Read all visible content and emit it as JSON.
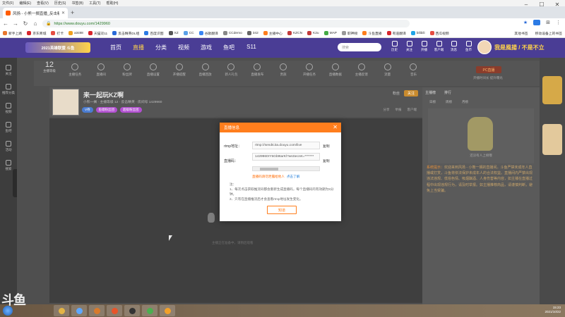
{
  "browser": {
    "menu": [
      "文件(F)",
      "编辑(E)",
      "查看(V)",
      "历史(S)",
      "书签(B)",
      "工具(T)",
      "帮助(H)"
    ],
    "tab_title": "风扬 - 小熊一搁直播_反击精彩...",
    "url": "https://www.douyu.com/1429960",
    "bookmarks": [
      {
        "label": "新手上路",
        "color": "#e8772e"
      },
      {
        "label": "京东商城",
        "color": "#d7262d"
      },
      {
        "label": "打卡",
        "color": "#e54d42"
      },
      {
        "label": "aini88",
        "color": "#f0a020"
      },
      {
        "label": "天猫双11",
        "color": "#d7262d"
      },
      {
        "label": "反击精英DL组",
        "color": "#2a6ad8"
      },
      {
        "label": "百度识图",
        "color": "#2c7be5"
      },
      {
        "label": "XZ",
        "color": "#555555"
      },
      {
        "label": "CC",
        "color": "#5aa0e8"
      },
      {
        "label": "谷歌翻译",
        "color": "#3a85f2"
      },
      {
        "label": "CCdemo",
        "color": "#888888"
      },
      {
        "label": "342",
        "color": "#666666"
      },
      {
        "label": "主播中心",
        "color": "#ff7e1d"
      },
      {
        "label": "KZCN",
        "color": "#c23b3b"
      },
      {
        "label": "K2u",
        "color": "#c23b3b"
      },
      {
        "label": "MAP",
        "color": "#44aa44"
      },
      {
        "label": "职神榜",
        "color": "#999999"
      },
      {
        "label": "斗鱼直播",
        "color": "#ff7e1d"
      },
      {
        "label": "有道翻译",
        "color": "#d7262d"
      },
      {
        "label": "bilibili",
        "color": "#21a4e6"
      },
      {
        "label": "西瓜视频",
        "color": "#e54d42"
      }
    ],
    "bookmarks_right": [
      "其他书签",
      "移动设备上的书签"
    ]
  },
  "douyu": {
    "logo_text": "2021英雄联盟 斗鱼",
    "nav": [
      {
        "label": "首页",
        "active": false
      },
      {
        "label": "直播",
        "active": true
      },
      {
        "label": "分类",
        "active": false
      },
      {
        "label": "视频",
        "active": false
      },
      {
        "label": "游戏",
        "active": false
      },
      {
        "label": "鱼吧",
        "active": false
      },
      {
        "label": "S11",
        "active": false
      }
    ],
    "search_placeholder": "搜索",
    "header_icons": [
      "历史",
      "关注",
      "开播",
      "客户端",
      "消息",
      "鱼币"
    ],
    "username": "我是風揚 / 不是不立"
  },
  "left_sidebar": [
    "关注",
    "推荐分类",
    "视频",
    "鱼吧",
    "活动",
    "搜索"
  ],
  "level": {
    "number": "12",
    "label": "主播等级"
  },
  "toolbar": [
    "主播任务",
    "直播间",
    "粉丝牌",
    "直播设置",
    "开播提醒",
    "直播回放",
    "新人礼包",
    "直播发布",
    "贵族",
    "开播任务",
    "直播数据",
    "主播反馈",
    "流量",
    "音乐",
    "节目单",
    "直播分享"
  ],
  "fc": {
    "button": "PC直播",
    "text": "开播时间长 提升曝光"
  },
  "room": {
    "title": "来一起玩KZ啊",
    "meta": "小熊一搁 · 主播等级 12 · 反击精英 · 房间号 1429960",
    "tags": [
      {
        "label": "V待",
        "color": "#4a7cd1"
      },
      {
        "label": "鱼塘粉丝团",
        "color": "#b24fd1"
      },
      {
        "label": "超级粉丝团",
        "color": "#b24fd1"
      }
    ],
    "right": [
      "粉丝",
      "关注"
    ],
    "follow": "关注",
    "actions": [
      "分享",
      "举报",
      "客户端"
    ]
  },
  "video": {
    "hint": "主播正在准备中，请稍后观看"
  },
  "right_panel": {
    "tabs": [
      "主播榜",
      "排行"
    ],
    "sub": [
      "日榜",
      "周榜",
      "月榜"
    ],
    "rank_caption": "还没有人上榜哦",
    "notice_label": "系统提示：",
    "notice": "欢迎来到风扬 - 小熊一搁的直播间。斗鱼严禁未成年人直播或打赏，斗鱼将依法保护未成年人的合法权益。直播间内严禁出现违法违规、低俗色情、吸烟酗酒、人身伤害等内容，如主播在直播过程中出现违规行为，请及时举报。如主播推荐商品，请谨慎判断，避免上当受骗。"
  },
  "modal": {
    "title": "直播信息",
    "rtmp_label": "rtmp地址：",
    "rtmp_value": "rtmp://sendtc3a.douyu.com/live",
    "key_label": "直播码：",
    "key_value": "1429960rY5Gb9tarKl?wsSecret=*******",
    "copy": "复制",
    "warning": "直播码请勿泄露给他人",
    "warning_link": "点击了解",
    "notes_title": "注：",
    "notes": [
      "1、每次点击获取推流码都会重新生成直播码，每个直播码的有效期为5分钟。",
      "2、只有在直播推流后才会查看rtmp地址发生变化。"
    ],
    "ok": "知道"
  },
  "taskbar": {
    "time": "15:23",
    "date": "2021/10/22"
  },
  "watermark": "斗鱼"
}
